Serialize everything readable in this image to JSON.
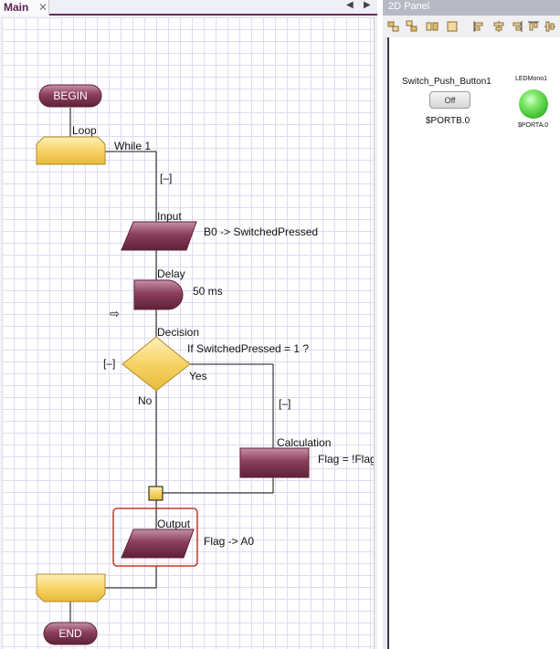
{
  "main_tab": {
    "label": "Main",
    "close": "✕",
    "nav_left": "◀",
    "nav_right": "▶"
  },
  "flowchart": {
    "begin": "BEGIN",
    "end": "END",
    "loop": {
      "title": "Loop",
      "condition": "While 1",
      "toggle": "[–]"
    },
    "input": {
      "title": "Input",
      "detail": "B0 -> SwitchedPressed"
    },
    "delay": {
      "title": "Delay",
      "detail": "50 ms"
    },
    "decision": {
      "title": "Decision",
      "detail": "If  SwitchedPressed = 1 ?",
      "yes": "Yes",
      "no": "No",
      "toggle_left": "[–]",
      "toggle_right": "[–]"
    },
    "calculation": {
      "title": "Calculation",
      "detail": "Flag = !Flag"
    },
    "output": {
      "title": "Output",
      "detail": "Flag -> A0"
    },
    "pointer_icon": "⇨"
  },
  "panel": {
    "title": "2D Panel",
    "switch": {
      "name": "Switch_Push_Button1",
      "button_label": "Off",
      "port": "$PORTB.0"
    },
    "led": {
      "name": "LEDMono1",
      "port": "$PORTA.0",
      "color": "#4fd13a"
    }
  },
  "colors": {
    "accent": "#6b2a5c",
    "block_dark": "#6e2a44",
    "block_light": "#b07088",
    "loop_yellow": "#f5d060",
    "selection": "#c0392b"
  },
  "toolbar_icons": [
    "align-icon-1",
    "align-icon-2",
    "align-icon-3",
    "align-icon-4",
    "align-icon-5",
    "align-icon-6",
    "align-icon-7",
    "align-icon-8",
    "align-icon-9"
  ]
}
